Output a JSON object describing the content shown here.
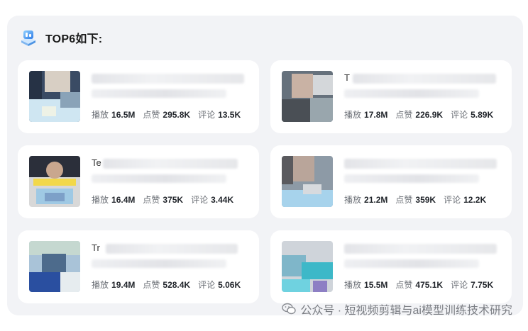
{
  "header": {
    "title": "TOP6如下:"
  },
  "cards": [
    {
      "thumb_colors": [
        "#3a4b64",
        "#d8cfc4",
        "#8aa3b8",
        "#cfe6f2"
      ],
      "title_prefix": "",
      "stats": [
        {
          "label": "播放",
          "value": "16.5M"
        },
        {
          "label": "点赞",
          "value": "295.8K"
        },
        {
          "label": "评论",
          "value": "13.5K"
        }
      ]
    },
    {
      "thumb_colors": [
        "#4a4f55",
        "#c9b2a4",
        "#66717c",
        "#99a6ad"
      ],
      "title_prefix": "T",
      "stats": [
        {
          "label": "播放",
          "value": "17.8M"
        },
        {
          "label": "点赞",
          "value": "226.9K"
        },
        {
          "label": "评论",
          "value": "5.89K"
        }
      ]
    },
    {
      "thumb_colors": [
        "#2b2f3a",
        "#d8d8d8",
        "#7da0c8",
        "#9fc9e4"
      ],
      "title_prefix": "Te",
      "stats": [
        {
          "label": "播放",
          "value": "16.4M"
        },
        {
          "label": "点赞",
          "value": "375K"
        },
        {
          "label": "评论",
          "value": "3.44K"
        }
      ]
    },
    {
      "thumb_colors": [
        "#5a5a5e",
        "#b9a59a",
        "#8d9aa6",
        "#a7d3ec"
      ],
      "title_prefix": "",
      "stats": [
        {
          "label": "播放",
          "value": "21.2M"
        },
        {
          "label": "点赞",
          "value": "359K"
        },
        {
          "label": "评论",
          "value": "12.2K"
        }
      ]
    },
    {
      "thumb_colors": [
        "#c5d8d0",
        "#4d6b8c",
        "#2a4fa0",
        "#a9c3d8"
      ],
      "title_prefix": "Tr",
      "stats": [
        {
          "label": "播放",
          "value": "19.4M"
        },
        {
          "label": "点赞",
          "value": "528.4K"
        },
        {
          "label": "评论",
          "value": "5.06K"
        }
      ]
    },
    {
      "thumb_colors": [
        "#cfd4da",
        "#7fb6c9",
        "#3db8c8",
        "#8d7fc4"
      ],
      "title_prefix": "",
      "stats": [
        {
          "label": "播放",
          "value": "15.5M"
        },
        {
          "label": "点赞",
          "value": "475.1K"
        },
        {
          "label": "评论",
          "value": "7.75K"
        }
      ]
    }
  ],
  "footer": {
    "text": "公众号 · 短视频剪辑与ai模型训练技术研究"
  },
  "colors": {
    "panel_bg": "#f2f3f6",
    "card_bg": "#ffffff",
    "accent": "#2f7be6"
  }
}
